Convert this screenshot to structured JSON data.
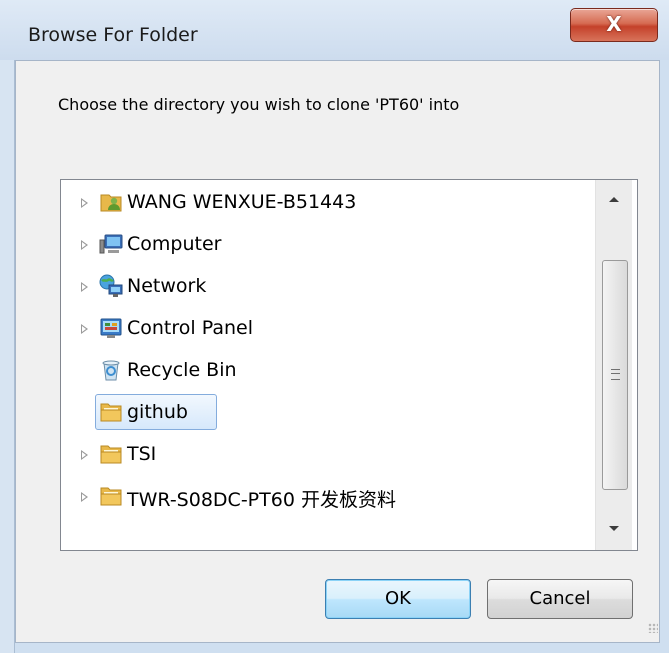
{
  "window": {
    "title": "Browse For Folder",
    "close_label": "X"
  },
  "prompt": "Choose the directory you wish to clone 'PT60' into",
  "tree": {
    "items": [
      {
        "label": "WANG WENXUE-B51443",
        "icon": "user-folder-icon",
        "expandable": true,
        "selected": false
      },
      {
        "label": "Computer",
        "icon": "computer-icon",
        "expandable": true,
        "selected": false
      },
      {
        "label": "Network",
        "icon": "network-icon",
        "expandable": true,
        "selected": false
      },
      {
        "label": "Control Panel",
        "icon": "control-panel-icon",
        "expandable": true,
        "selected": false
      },
      {
        "label": "Recycle Bin",
        "icon": "recycle-bin-icon",
        "expandable": false,
        "selected": false
      },
      {
        "label": "github",
        "icon": "folder-icon",
        "expandable": false,
        "selected": true
      },
      {
        "label": "TSI",
        "icon": "folder-icon",
        "expandable": true,
        "selected": false
      },
      {
        "label": "TWR-S08DC-PT60 开发板资料",
        "icon": "folder-icon",
        "expandable": true,
        "selected": false
      }
    ]
  },
  "buttons": {
    "ok": "OK",
    "cancel": "Cancel"
  },
  "colors": {
    "titlebar": "#dfeaf6",
    "close_button": "#c4412a",
    "selection": "#d6e8fb",
    "folder": "#e8b84a"
  }
}
